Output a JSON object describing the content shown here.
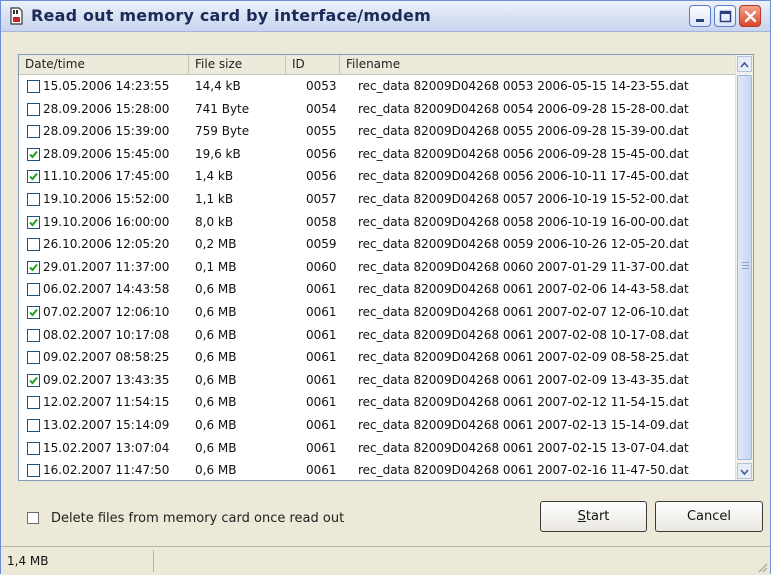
{
  "window": {
    "title": "Read out memory card by interface/modem",
    "buttons": [
      "minimize",
      "maximize",
      "close"
    ]
  },
  "list": {
    "columns": [
      "Date/time",
      "File size",
      "ID",
      "Filename"
    ],
    "rows": [
      {
        "checked": false,
        "date": "15.05.2006 14:23:55",
        "size": "14,4 kB",
        "id": "0053",
        "name": "rec_data 82009D04268 0053 2006-05-15 14-23-55.dat"
      },
      {
        "checked": false,
        "date": "28.09.2006 15:28:00",
        "size": "741 Byte",
        "id": "0054",
        "name": "rec_data 82009D04268 0054 2006-09-28 15-28-00.dat"
      },
      {
        "checked": false,
        "date": "28.09.2006 15:39:00",
        "size": "759 Byte",
        "id": "0055",
        "name": "rec_data 82009D04268 0055 2006-09-28 15-39-00.dat"
      },
      {
        "checked": true,
        "date": "28.09.2006 15:45:00",
        "size": "19,6 kB",
        "id": "0056",
        "name": "rec_data 82009D04268 0056 2006-09-28 15-45-00.dat"
      },
      {
        "checked": true,
        "date": "11.10.2006 17:45:00",
        "size": "1,4 kB",
        "id": "0056",
        "name": "rec_data 82009D04268 0056 2006-10-11 17-45-00.dat"
      },
      {
        "checked": false,
        "date": "19.10.2006 15:52:00",
        "size": "1,1 kB",
        "id": "0057",
        "name": "rec_data 82009D04268 0057 2006-10-19 15-52-00.dat"
      },
      {
        "checked": true,
        "date": "19.10.2006 16:00:00",
        "size": "8,0 kB",
        "id": "0058",
        "name": "rec_data 82009D04268 0058 2006-10-19 16-00-00.dat"
      },
      {
        "checked": false,
        "date": "26.10.2006 12:05:20",
        "size": "0,2 MB",
        "id": "0059",
        "name": "rec_data 82009D04268 0059 2006-10-26 12-05-20.dat"
      },
      {
        "checked": true,
        "date": "29.01.2007 11:37:00",
        "size": "0,1 MB",
        "id": "0060",
        "name": "rec_data 82009D04268 0060 2007-01-29 11-37-00.dat"
      },
      {
        "checked": false,
        "date": "06.02.2007 14:43:58",
        "size": "0,6 MB",
        "id": "0061",
        "name": "rec_data 82009D04268 0061 2007-02-06 14-43-58.dat"
      },
      {
        "checked": true,
        "date": "07.02.2007 12:06:10",
        "size": "0,6 MB",
        "id": "0061",
        "name": "rec_data 82009D04268 0061 2007-02-07 12-06-10.dat"
      },
      {
        "checked": false,
        "date": "08.02.2007 10:17:08",
        "size": "0,6 MB",
        "id": "0061",
        "name": "rec_data 82009D04268 0061 2007-02-08 10-17-08.dat"
      },
      {
        "checked": false,
        "date": "09.02.2007 08:58:25",
        "size": "0,6 MB",
        "id": "0061",
        "name": "rec_data 82009D04268 0061 2007-02-09 08-58-25.dat"
      },
      {
        "checked": true,
        "date": "09.02.2007 13:43:35",
        "size": "0,6 MB",
        "id": "0061",
        "name": "rec_data 82009D04268 0061 2007-02-09 13-43-35.dat"
      },
      {
        "checked": false,
        "date": "12.02.2007 11:54:15",
        "size": "0,6 MB",
        "id": "0061",
        "name": "rec_data 82009D04268 0061 2007-02-12 11-54-15.dat"
      },
      {
        "checked": false,
        "date": "13.02.2007 15:14:09",
        "size": "0,6 MB",
        "id": "0061",
        "name": "rec_data 82009D04268 0061 2007-02-13 15-14-09.dat"
      },
      {
        "checked": false,
        "date": "15.02.2007 13:07:04",
        "size": "0,6 MB",
        "id": "0061",
        "name": "rec_data 82009D04268 0061 2007-02-15 13-07-04.dat"
      },
      {
        "checked": false,
        "date": "16.02.2007 11:47:50",
        "size": "0,6 MB",
        "id": "0061",
        "name": "rec_data 82009D04268 0061 2007-02-16 11-47-50.dat"
      }
    ]
  },
  "options": {
    "delete_after_read_label": "Delete files from memory card once read out",
    "delete_after_read_checked": false
  },
  "buttons": {
    "start_mnemonic": "S",
    "start_rest": "tart",
    "cancel": "Cancel"
  },
  "status": {
    "selected_size": "1,4 MB"
  },
  "icons": {
    "app": "memory-card-icon",
    "scroll_up": "chevron-up-icon",
    "scroll_down": "chevron-down-icon"
  },
  "colors": {
    "title_text": "#1b2a57",
    "close_button": "#d8472c",
    "list_border": "#7f9db9",
    "dialog_bg": "#ece9d8"
  }
}
